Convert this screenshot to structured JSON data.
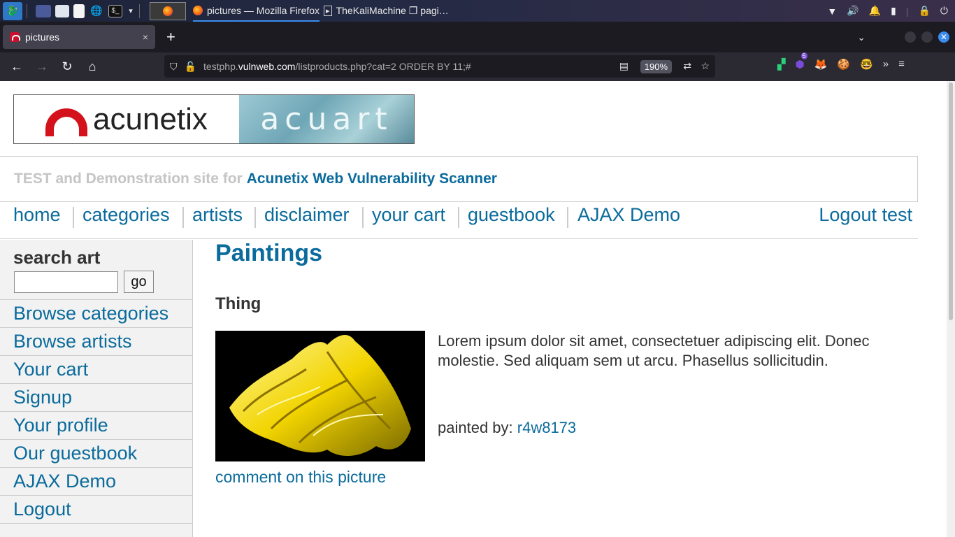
{
  "taskbar": {
    "firefox_task_title": "pictures — Mozilla Firefox",
    "terminal_task_title": "TheKaliMachine ❐ pagi…"
  },
  "browser": {
    "tab_title": "pictures",
    "tab_close": "×",
    "new_tab": "+",
    "url_prefix": "testphp.",
    "url_domain": "vulnweb.com",
    "url_path": "/listproducts.php?cat=2 ORDER BY 11;#",
    "zoom": "190%",
    "ext_badge": "5"
  },
  "site": {
    "logo_left": "acunetix",
    "logo_right": "acuart",
    "tagline_grey": "TEST and Demonstration site for",
    "tagline_blue": "Acunetix Web Vulnerability Scanner",
    "nav": [
      "home",
      "categories",
      "artists",
      "disclaimer",
      "your cart",
      "guestbook",
      "AJAX Demo"
    ],
    "logout": "Logout test"
  },
  "sidebar": {
    "search_heading": "search art",
    "search_value": "",
    "go_label": "go",
    "links": [
      "Browse categories",
      "Browse artists",
      "Your cart",
      "Signup",
      "Your profile",
      "Our guestbook",
      "AJAX Demo",
      "Logout"
    ]
  },
  "content": {
    "heading": "Paintings",
    "title": "Thing",
    "description": "Lorem ipsum dolor sit amet, consectetuer adipiscing elit. Donec molestie. Sed aliquam sem ut arcu. Phasellus sollicitudin.",
    "painted_by_label": "painted by:",
    "artist": "r4w8173",
    "comment_link": "comment on this picture"
  },
  "colors": {
    "link": "#0a6b9c",
    "tagline_grey": "#c5c5c5",
    "acunetix_red": "#d3121b"
  }
}
